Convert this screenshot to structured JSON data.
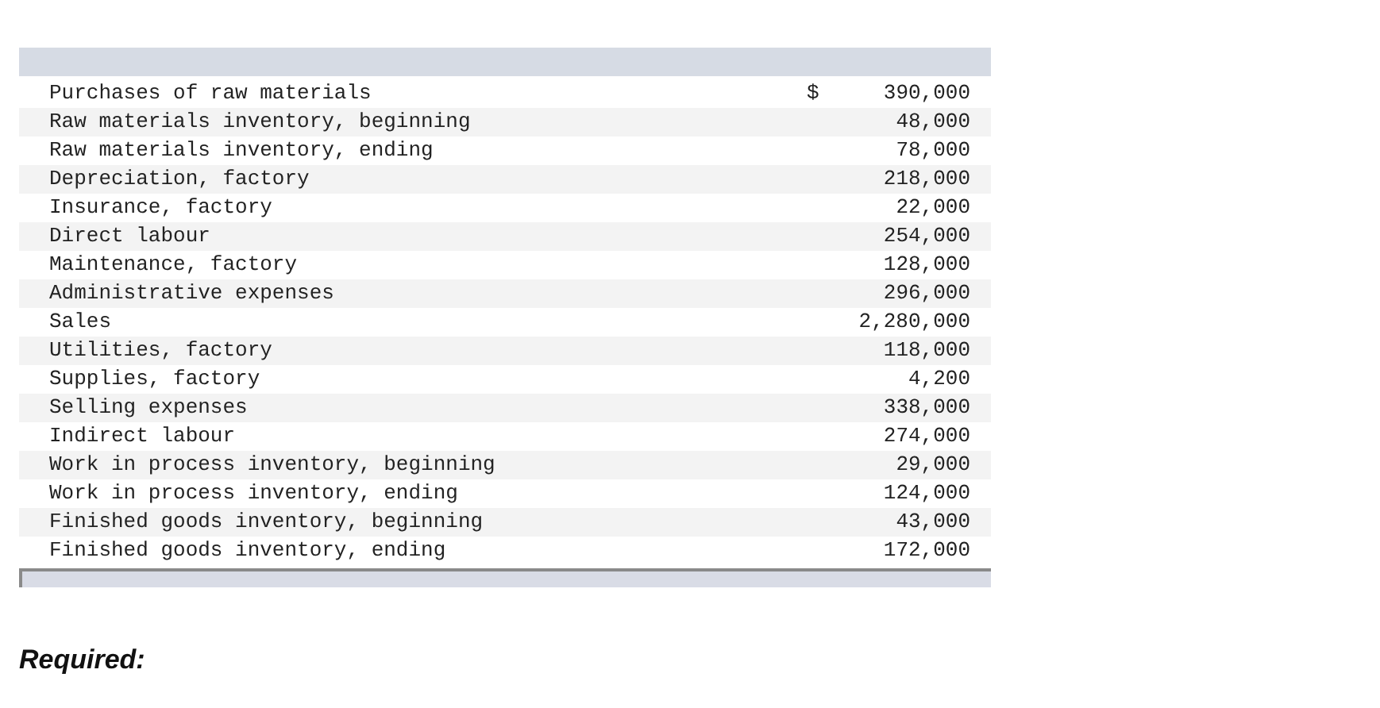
{
  "table": {
    "rows": [
      {
        "label": "Purchases of raw materials",
        "currency": "$",
        "amount": "390,000"
      },
      {
        "label": "Raw materials inventory, beginning",
        "amount": "48,000"
      },
      {
        "label": "Raw materials inventory, ending",
        "amount": "78,000"
      },
      {
        "label": "Depreciation, factory",
        "amount": "218,000"
      },
      {
        "label": "Insurance, factory",
        "amount": "22,000"
      },
      {
        "label": "Direct labour",
        "amount": "254,000"
      },
      {
        "label": "Maintenance, factory",
        "amount": "128,000"
      },
      {
        "label": "Administrative expenses",
        "amount": "296,000"
      },
      {
        "label": "Sales",
        "amount": "2,280,000"
      },
      {
        "label": "Utilities, factory",
        "amount": "118,000"
      },
      {
        "label": "Supplies, factory",
        "amount": "4,200"
      },
      {
        "label": "Selling expenses",
        "amount": "338,000"
      },
      {
        "label": "Indirect labour",
        "amount": "274,000"
      },
      {
        "label": "Work in process inventory, beginning",
        "amount": "29,000"
      },
      {
        "label": "Work in process inventory, ending",
        "amount": "124,000"
      },
      {
        "label": "Finished goods inventory, beginning",
        "amount": "43,000"
      },
      {
        "label": "Finished goods inventory, ending",
        "amount": "172,000"
      }
    ]
  },
  "heading": "Required:"
}
